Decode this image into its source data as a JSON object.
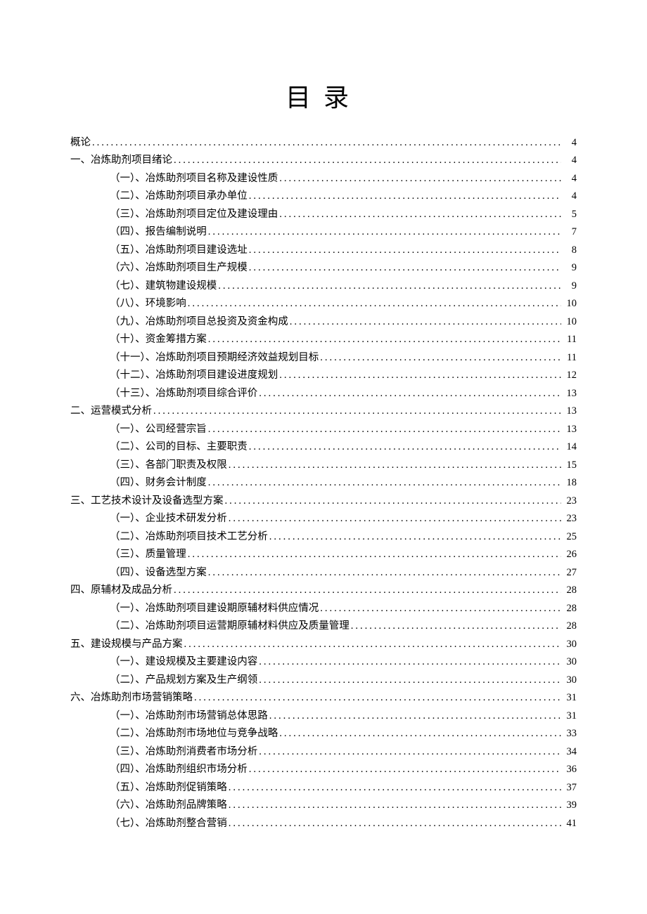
{
  "title": "目录",
  "entries": [
    {
      "level": 0,
      "label": "概论",
      "page": "4"
    },
    {
      "level": 1,
      "label": "一、冶炼助剂项目绪论",
      "page": "4"
    },
    {
      "level": 2,
      "label": "（一）、冶炼助剂项目名称及建设性质",
      "page": "4"
    },
    {
      "level": 2,
      "label": "（二）、冶炼助剂项目承办单位",
      "page": "4"
    },
    {
      "level": 2,
      "label": "（三）、冶炼助剂项目定位及建设理由",
      "page": "5"
    },
    {
      "level": 2,
      "label": "（四）、报告编制说明",
      "page": "7"
    },
    {
      "level": 2,
      "label": "（五）、冶炼助剂项目建设选址",
      "page": "8"
    },
    {
      "level": 2,
      "label": "（六）、冶炼助剂项目生产规模",
      "page": "9"
    },
    {
      "level": 2,
      "label": "（七）、建筑物建设规模",
      "page": "9"
    },
    {
      "level": 2,
      "label": "（八）、环境影响",
      "page": "10"
    },
    {
      "level": 2,
      "label": "（九）、冶炼助剂项目总投资及资金构成",
      "page": "10"
    },
    {
      "level": 2,
      "label": "（十）、资金筹措方案",
      "page": "11"
    },
    {
      "level": 2,
      "label": "（十一）、冶炼助剂项目预期经济效益规划目标",
      "page": "11"
    },
    {
      "level": 2,
      "label": "（十二）、冶炼助剂项目建设进度规划",
      "page": "12"
    },
    {
      "level": 2,
      "label": "（十三）、冶炼助剂项目综合评价",
      "page": "13"
    },
    {
      "level": 1,
      "label": "二、运营模式分析",
      "page": "13"
    },
    {
      "level": 2,
      "label": "（一）、公司经营宗旨",
      "page": "13"
    },
    {
      "level": 2,
      "label": "（二）、公司的目标、主要职责",
      "page": "14"
    },
    {
      "level": 2,
      "label": "（三）、各部门职责及权限",
      "page": "15"
    },
    {
      "level": 2,
      "label": "（四）、财务会计制度",
      "page": "18"
    },
    {
      "level": 1,
      "label": "三、工艺技术设计及设备选型方案",
      "page": "23"
    },
    {
      "level": 2,
      "label": "（一）、企业技术研发分析",
      "page": "23"
    },
    {
      "level": 2,
      "label": "（二）、冶炼助剂项目技术工艺分析",
      "page": "25"
    },
    {
      "level": 2,
      "label": "（三）、质量管理",
      "page": "26"
    },
    {
      "level": 2,
      "label": "（四）、设备选型方案",
      "page": "27"
    },
    {
      "level": 1,
      "label": "四、原辅材及成品分析",
      "page": "28"
    },
    {
      "level": 2,
      "label": "（一）、冶炼助剂项目建设期原辅材料供应情况",
      "page": "28"
    },
    {
      "level": 2,
      "label": "（二）、冶炼助剂项目运营期原辅材料供应及质量管理",
      "page": "28"
    },
    {
      "level": 1,
      "label": "五、建设规模与产品方案",
      "page": "30"
    },
    {
      "level": 2,
      "label": "（一）、建设规模及主要建设内容",
      "page": "30"
    },
    {
      "level": 2,
      "label": "（二）、产品规划方案及生产纲领",
      "page": "30"
    },
    {
      "level": 1,
      "label": "六、冶炼助剂市场营销策略",
      "page": "31"
    },
    {
      "level": 2,
      "label": "（一）、冶炼助剂市场营销总体思路",
      "page": "31"
    },
    {
      "level": 2,
      "label": "（二）、冶炼助剂市场地位与竞争战略",
      "page": "33"
    },
    {
      "level": 2,
      "label": "（三）、冶炼助剂消费者市场分析",
      "page": "34"
    },
    {
      "level": 2,
      "label": "（四）、冶炼助剂组织市场分析",
      "page": "36"
    },
    {
      "level": 2,
      "label": "（五）、冶炼助剂促销策略",
      "page": "37"
    },
    {
      "level": 2,
      "label": "（六）、冶炼助剂品牌策略",
      "page": "39"
    },
    {
      "level": 2,
      "label": "（七）、冶炼助剂整合营销",
      "page": "41"
    }
  ]
}
